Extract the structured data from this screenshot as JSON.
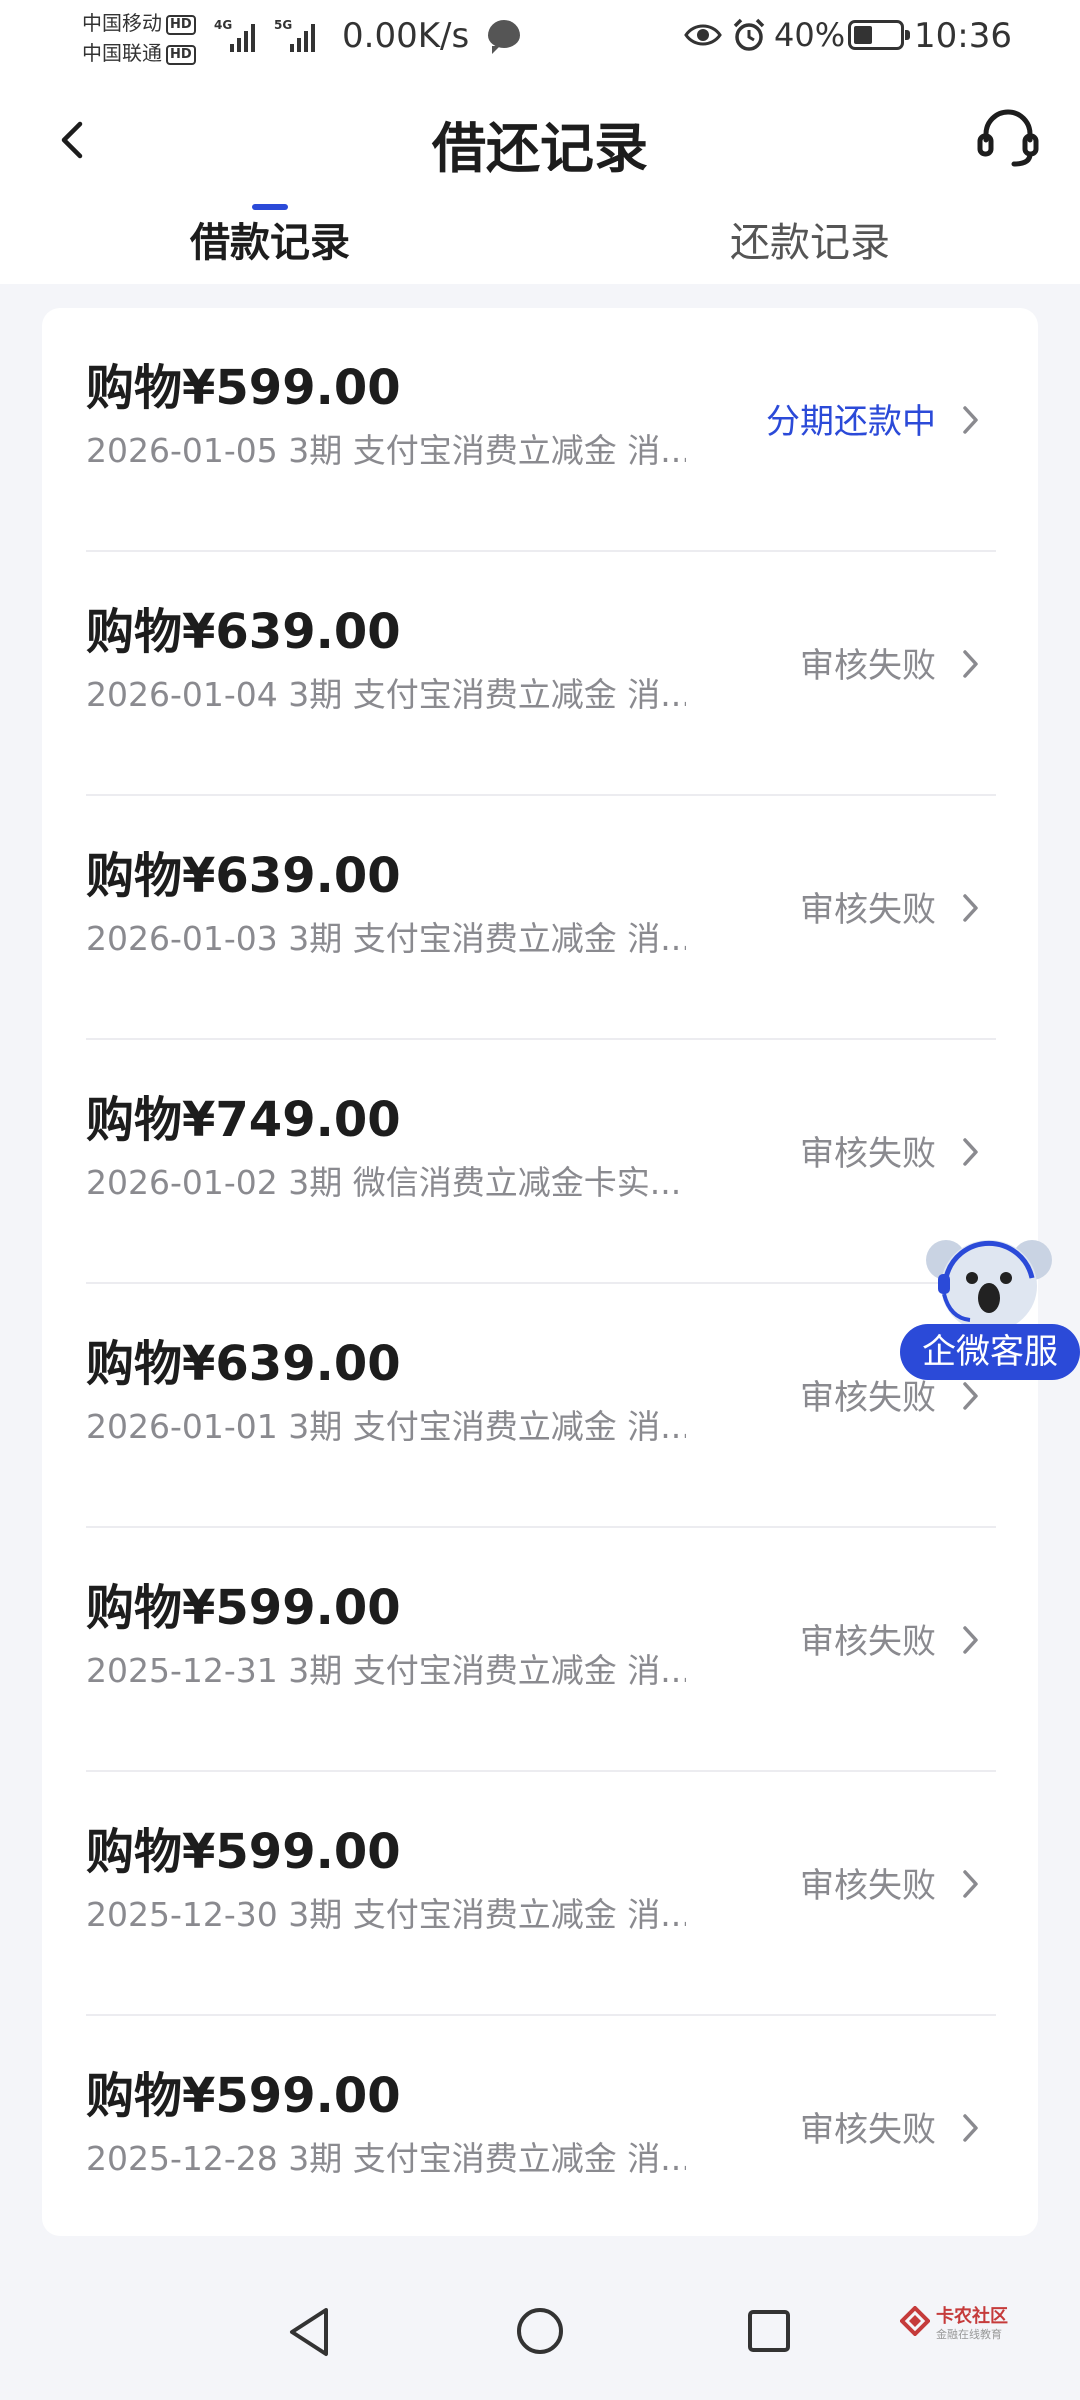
{
  "status_bar": {
    "carrier_1": "中国移动",
    "carrier_2": "中国联通",
    "hd_label": "HD",
    "sim1_network": "4G",
    "sim2_network": "5G",
    "net_speed": "0.00K/s",
    "battery_percent": "40%",
    "battery_level": 0.4,
    "time": "10:36"
  },
  "header": {
    "title": "借还记录",
    "back_icon": "chevron-left-icon",
    "support_icon": "headset-icon"
  },
  "tabs": [
    {
      "label": "借款记录",
      "active": true
    },
    {
      "label": "还款记录",
      "active": false
    }
  ],
  "records": [
    {
      "amount": "购物¥599.00",
      "detail": "2026-01-05 3期 支付宝消费立减金 消...",
      "status": "分期还款中",
      "active": true
    },
    {
      "amount": "购物¥639.00",
      "detail": "2026-01-04 3期 支付宝消费立减金 消...",
      "status": "审核失败",
      "active": false
    },
    {
      "amount": "购物¥639.00",
      "detail": "2026-01-03 3期 支付宝消费立减金 消...",
      "status": "审核失败",
      "active": false
    },
    {
      "amount": "购物¥749.00",
      "detail": "2026-01-02 3期 微信消费立减金卡实...",
      "status": "审核失败",
      "active": false
    },
    {
      "amount": "购物¥639.00",
      "detail": "2026-01-01 3期 支付宝消费立减金 消...",
      "status": "审核失败",
      "active": false
    },
    {
      "amount": "购物¥599.00",
      "detail": "2025-12-31 3期 支付宝消费立减金 消...",
      "status": "审核失败",
      "active": false
    },
    {
      "amount": "购物¥599.00",
      "detail": "2025-12-30 3期 支付宝消费立减金 消...",
      "status": "审核失败",
      "active": false
    },
    {
      "amount": "购物¥599.00",
      "detail": "2025-12-28 3期 支付宝消费立减金 消...",
      "status": "审核失败",
      "active": false
    }
  ],
  "floating_support": {
    "label": "企微客服",
    "icon": "koala-mascot-icon"
  },
  "nav_bar": {
    "back_icon": "triangle-back-icon",
    "home_icon": "circle-home-icon",
    "recent_icon": "square-recent-icon"
  },
  "watermark": {
    "name": "卡农社区",
    "subtitle": "金融在线教育"
  },
  "colors": {
    "accent": "#2b4ad8",
    "muted_text": "#8a8a8f",
    "primary_text": "#1d1d1d",
    "background": "#f4f5f9"
  }
}
